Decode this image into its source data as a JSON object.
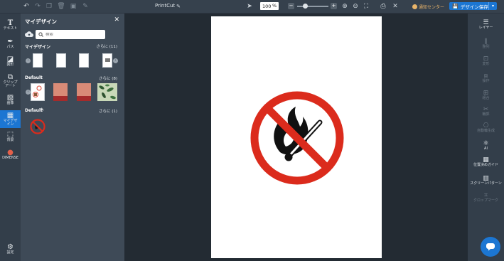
{
  "app": {
    "document_title": "PrintCut"
  },
  "toolbar": {
    "zoom_value": "100",
    "zoom_unit": "%",
    "zoom_level": 0.25,
    "notify_label": "通知センター",
    "save_label": "デザイン保存"
  },
  "left_nav": {
    "text": "テキスト",
    "path": "パス",
    "shapes": "図形",
    "clipart": "クリップアート",
    "images": "画像",
    "my_design": "マイデザイン",
    "background": "背景",
    "dimense": "DIMENSE",
    "settings": "設定"
  },
  "panel": {
    "title": "マイデザイン",
    "search_placeholder": "検索",
    "sections": [
      {
        "title": "マイデザイン",
        "more": "さらに (11)"
      },
      {
        "title": "Default",
        "more": "さらに (8)"
      },
      {
        "title": "Default",
        "more": "さらに (1)"
      }
    ]
  },
  "right_nav": {
    "layers": "レイヤー",
    "align": "整列",
    "transform": "変形",
    "operations": "操作",
    "group": "組合",
    "cut": "輪郭",
    "auto_gen": "自動輪生成",
    "ai": "AI",
    "guides": "位置決めガイド",
    "screen_pattern": "スクリーンパターン",
    "crop_marks": "クロップマーク"
  },
  "colors": {
    "accent": "#1c76d2",
    "prohibit_red": "#db2b1c",
    "notify": "#e9b46a"
  }
}
